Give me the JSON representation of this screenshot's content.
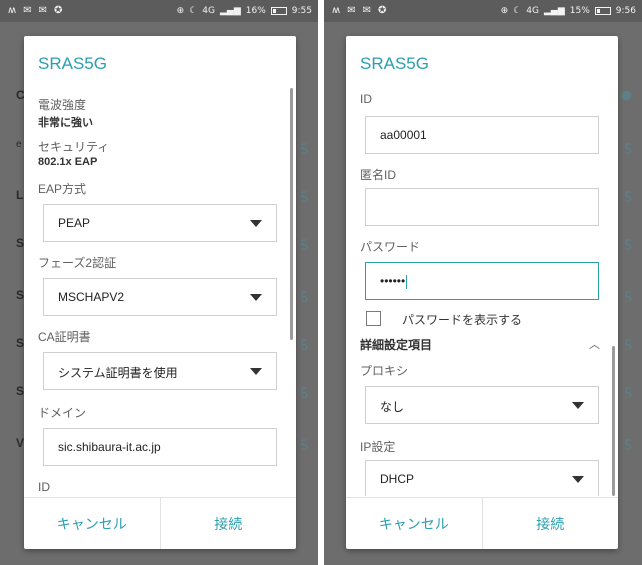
{
  "status_bar": {
    "left": {
      "signal_1": 16,
      "time": "9:55"
    },
    "right": {
      "signal_1": 15,
      "time": "9:56"
    },
    "network": "4G",
    "battery_left": "16%",
    "battery_right": "15%",
    "left_icons": [
      "M",
      "mail-icon",
      "mail-icon",
      "notification-icon"
    ]
  },
  "dialog_title": "SRAS5G",
  "left_screen": {
    "signal_strength_label": "電波強度",
    "signal_strength_value": "非常に強い",
    "security_label": "セキュリティ",
    "security_value": "802.1x EAP",
    "eap_method_label": "EAP方式",
    "eap_method_value": "PEAP",
    "phase2_label": "フェーズ2認証",
    "phase2_value": "MSCHAPV2",
    "ca_cert_label": "CA証明書",
    "ca_cert_value": "システム証明書を使用",
    "domain_label": "ドメイン",
    "domain_value": "sic.shibaura-it.ac.jp",
    "id_label": "ID"
  },
  "right_screen": {
    "id_label": "ID",
    "id_value": "aa00001",
    "anon_id_label": "匿名ID",
    "anon_id_value": "",
    "password_label": "パスワード",
    "password_value": "••••••",
    "show_password_label": "パスワードを表示する",
    "advanced_label": "詳細設定項目",
    "proxy_label": "プロキシ",
    "proxy_value": "なし",
    "ip_label": "IP設定",
    "ip_value": "DHCP"
  },
  "buttons": {
    "cancel": "キャンセル",
    "connect": "接続"
  },
  "background_letters_left": [
    "C",
    "e",
    "L",
    "S",
    "S",
    "S",
    "S",
    "V"
  ],
  "background_letters_right": [],
  "colors": {
    "accent": "#2a9fb0",
    "dim": "#6d6d6d"
  }
}
